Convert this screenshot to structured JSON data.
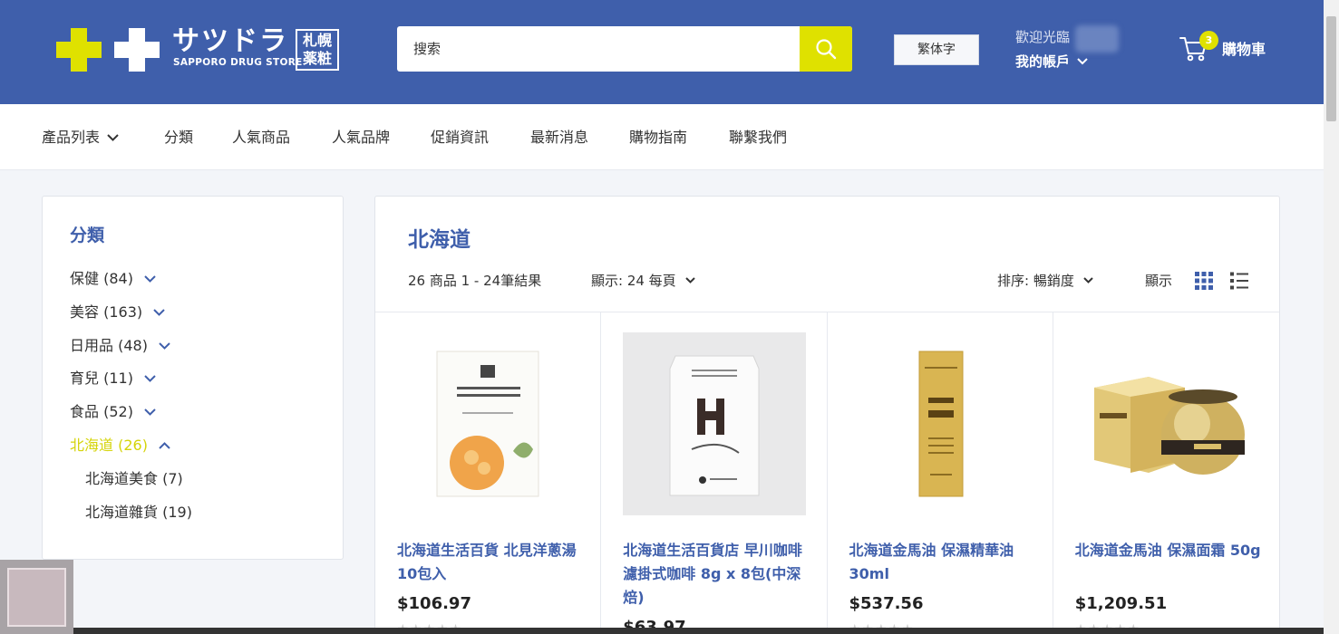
{
  "header": {
    "logo_jp": "サツドラ",
    "logo_en": "SAPPORO DRUG STORE",
    "logo_kanji_1": "札幌",
    "logo_kanji_2": "薬粧",
    "search_placeholder": "搜索",
    "lang_button": "繁体字",
    "welcome": "歡迎光臨",
    "account_label": "我的帳戶",
    "cart_count": "3",
    "cart_label": "購物車",
    "colors": {
      "brand_blue": "#3f5fab",
      "accent_yellow": "#dfe100"
    }
  },
  "nav": {
    "items": [
      "產品列表",
      "分類",
      "人氣商品",
      "人氣品牌",
      "促銷資訊",
      "最新消息",
      "購物指南",
      "聯繫我們"
    ]
  },
  "sidebar": {
    "title": "分類",
    "categories": [
      {
        "label": "保健 (84)",
        "icon": "chevron-down-icon"
      },
      {
        "label": "美容 (163)",
        "icon": "chevron-down-icon"
      },
      {
        "label": "日用品 (48)",
        "icon": "chevron-down-icon"
      },
      {
        "label": "育兒 (11)",
        "icon": "chevron-down-icon"
      },
      {
        "label": "食品 (52)",
        "icon": "chevron-down-icon"
      },
      {
        "label": "北海道 (26)",
        "icon": "chevron-up-icon",
        "active": true
      }
    ],
    "subcategories": [
      "北海道美食 (7)",
      "北海道雜貨 (19)"
    ]
  },
  "main": {
    "title": "北海道",
    "results": "26 商品 1 - 24筆結果",
    "per_page": "顯示: 24 每頁",
    "sort": "排序: 暢銷度",
    "view_label": "顯示"
  },
  "products": [
    {
      "title": "北海道生活百貨 北見洋蔥湯 10包入",
      "price": "$106.97",
      "image": "onion-soup-box"
    },
    {
      "title": "北海道生活百貨店 早川咖啡 濾掛式咖啡 8g x 8包(中深焙)",
      "price": "$63.97",
      "image": "drip-coffee-bag"
    },
    {
      "title": "北海道金馬油 保濕精華油 30ml",
      "price": "$537.56",
      "image": "horse-oil-bottle"
    },
    {
      "title": "北海道金馬油 保濕面霜 50g",
      "price": "$1,209.51",
      "image": "horse-oil-cream"
    }
  ]
}
